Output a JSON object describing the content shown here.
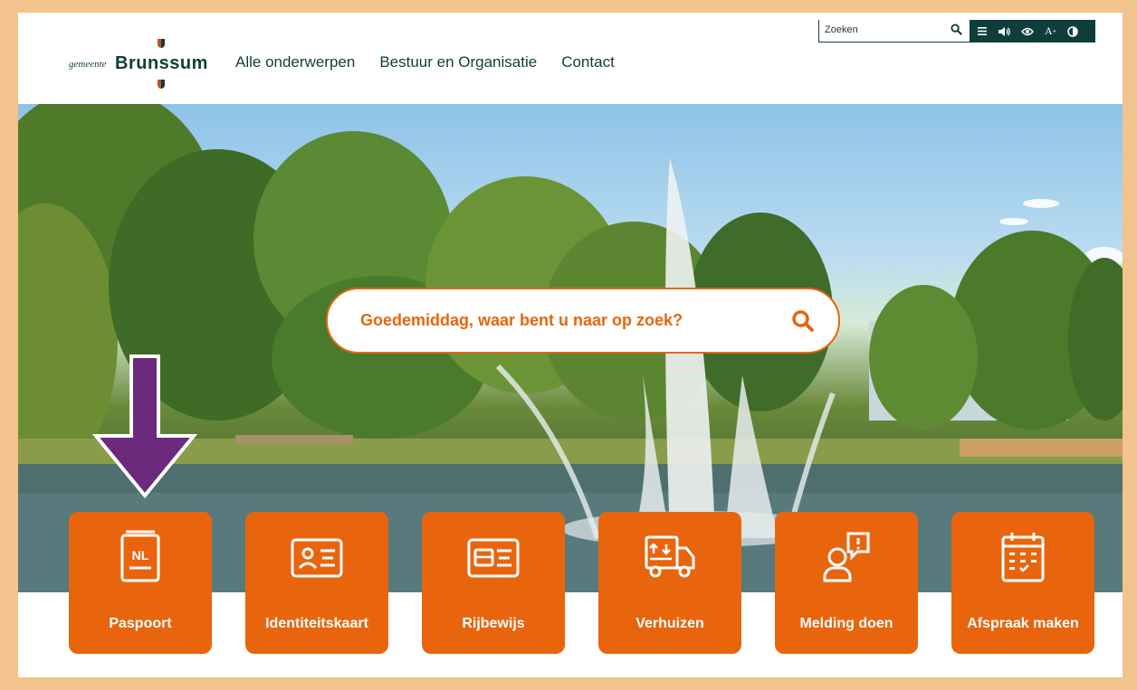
{
  "header": {
    "logo": {
      "small": "gemeente",
      "big": "Brunssum"
    },
    "nav": [
      "Alle onderwerpen",
      "Bestuur en Organisatie",
      "Contact"
    ]
  },
  "utility": {
    "search_placeholder": "Zoeken",
    "tools": [
      "menu-icon",
      "speaker-icon",
      "eye-icon",
      "text-size-icon",
      "contrast-icon"
    ],
    "text_size_label": "A",
    "text_size_sup": "+"
  },
  "hero": {
    "search_placeholder": "Goedemiddag, waar bent u naar op zoek?"
  },
  "tiles": [
    {
      "label": "Paspoort",
      "icon": "passport-icon",
      "icon_text": "NL"
    },
    {
      "label": "Identiteitskaart",
      "icon": "id-card-icon"
    },
    {
      "label": "Rijbewijs",
      "icon": "drivers-license-icon"
    },
    {
      "label": "Verhuizen",
      "icon": "moving-truck-icon"
    },
    {
      "label": "Melding doen",
      "icon": "report-icon"
    },
    {
      "label": "Afspraak maken",
      "icon": "calendar-icon"
    }
  ],
  "colors": {
    "accent": "#e8650e",
    "brand": "#0f3e3a",
    "frame": "#f2c38c",
    "annotation": "#6b2a7c"
  }
}
